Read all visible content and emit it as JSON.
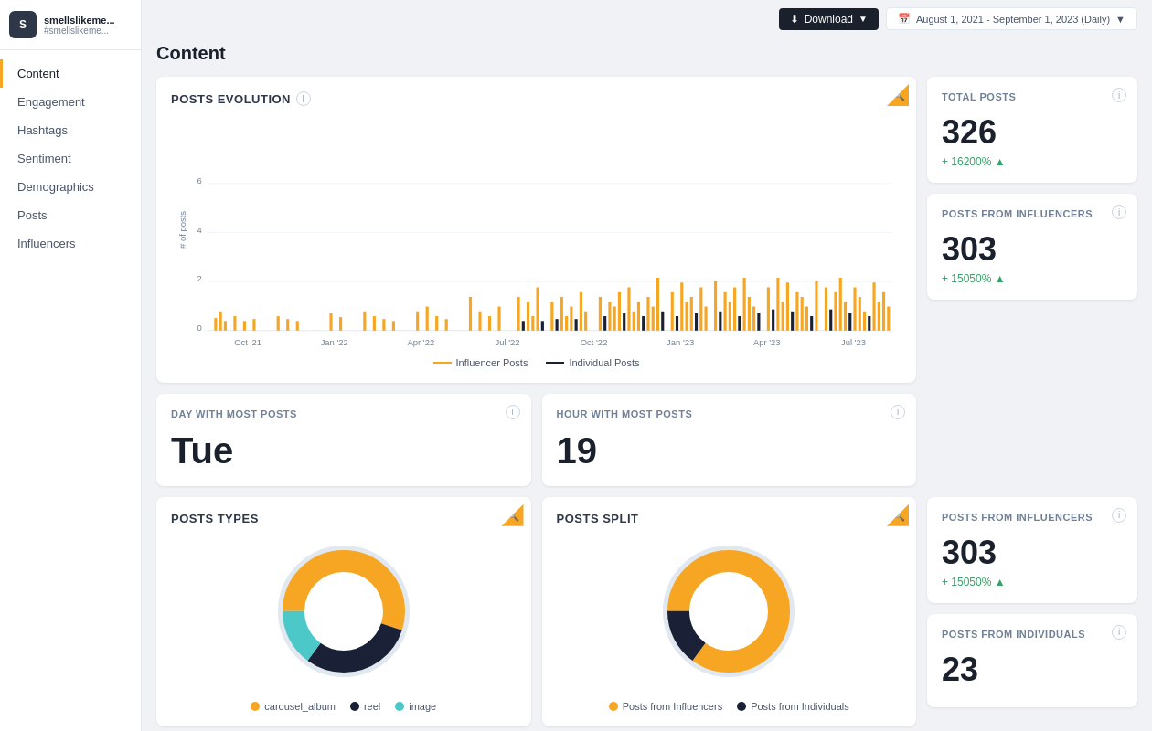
{
  "sidebar": {
    "avatar_initials": "S",
    "account_name": "smellslikeme...",
    "account_handle": "#smellslikeme...",
    "items": [
      {
        "label": "Content",
        "active": true
      },
      {
        "label": "Engagement",
        "active": false
      },
      {
        "label": "Hashtags",
        "active": false
      },
      {
        "label": "Sentiment",
        "active": false
      },
      {
        "label": "Demographics",
        "active": false
      },
      {
        "label": "Posts",
        "active": false
      },
      {
        "label": "Influencers",
        "active": false
      }
    ]
  },
  "topbar": {
    "download_label": "Download",
    "date_range_label": "August 1, 2021 - September 1, 2023 (Daily)"
  },
  "page": {
    "title": "Content"
  },
  "posts_evolution": {
    "title": "POSTS EVOLUTION",
    "legend_influencer": "Influencer Posts",
    "legend_individual": "Individual Posts",
    "y_axis_label": "# of posts",
    "x_labels": [
      "Oct '21",
      "Jan '22",
      "Apr '22",
      "Jul '22",
      "Oct '22",
      "Jan '23",
      "Apr '23",
      "Jul '23"
    ],
    "y_ticks": [
      "0",
      "2",
      "4",
      "6"
    ]
  },
  "total_posts": {
    "title": "TOTAL POSTS",
    "value": "326",
    "change": "+ 16200% ▲"
  },
  "posts_from_influencers_top": {
    "title": "POSTS FROM INFLUENCERS",
    "value": "303",
    "change": "+ 15050% ▲"
  },
  "day_with_most_posts": {
    "title": "DAY WITH MOST POSTS",
    "value": "Tue"
  },
  "hour_with_most_posts": {
    "title": "HOUR WITH MOST POSTS",
    "value": "19"
  },
  "posts_types": {
    "title": "POSTS TYPES",
    "legend": [
      {
        "label": "carousel_album",
        "color": "#f6a623"
      },
      {
        "label": "reel",
        "color": "#1a2035"
      },
      {
        "label": "image",
        "color": "#4dc8c8"
      }
    ],
    "donut": {
      "segments": [
        {
          "value": 55,
          "color": "#f6a623"
        },
        {
          "value": 30,
          "color": "#1a2035"
        },
        {
          "value": 15,
          "color": "#4dc8c8"
        }
      ]
    }
  },
  "posts_split": {
    "title": "POSTS SPLIT",
    "legend": [
      {
        "label": "Posts from Influencers",
        "color": "#f6a623"
      },
      {
        "label": "Posts from Individuals",
        "color": "#1a2035"
      }
    ],
    "donut": {
      "segments": [
        {
          "value": 85,
          "color": "#f6a623"
        },
        {
          "value": 15,
          "color": "#1a2035"
        }
      ]
    }
  },
  "posts_from_influencers_bottom": {
    "title": "POSTS FROM INFLUENCERS",
    "value": "303",
    "change": "+ 15050% ▲"
  },
  "posts_from_individuals": {
    "title": "POSTS FROM INDIVIDUALS",
    "value": "23"
  }
}
